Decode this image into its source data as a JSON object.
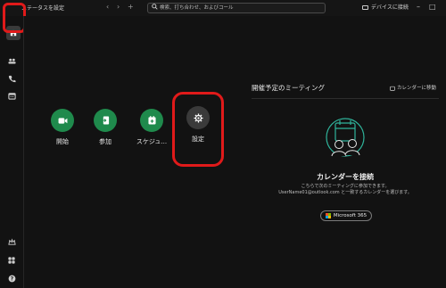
{
  "topbar": {
    "status_text": "ステータスを設定",
    "back": "‹",
    "forward": "›",
    "add": "+",
    "search_placeholder": "検索、打ち合わせ、およびコール",
    "device_label": "デバイスに接続",
    "minimize": "–",
    "maximize": "□"
  },
  "sidebar": {
    "items": [
      {
        "icon": "home-icon"
      },
      {
        "icon": "team-icon"
      },
      {
        "icon": "phone-icon"
      },
      {
        "icon": "calendar-icon"
      },
      {
        "icon": "whats-new-icon"
      },
      {
        "icon": "apps-icon"
      },
      {
        "icon": "help-icon"
      }
    ]
  },
  "actions": [
    {
      "label": "開始",
      "icon": "video-icon",
      "color": "#1f8a4c"
    },
    {
      "label": "参加",
      "icon": "join-icon",
      "color": "#1f8a4c"
    },
    {
      "label": "スケジュ...",
      "icon": "schedule-icon",
      "color": "#1f8a4c"
    },
    {
      "label": "設定",
      "icon": "gear-icon",
      "color": "#3a3a3a"
    }
  ],
  "meetings": {
    "title": "開催予定のミーティング",
    "move_to_calendar": "カレンダーに移動",
    "connect_title": "カレンダーを接続",
    "connect_desc_line1": "こちらで次のミーティングに参加できます。",
    "connect_desc_line2": "UserName01@outlook.com と一致するカレンダーを選びます。",
    "microsoft_button": "Microsoft 365"
  },
  "colors": {
    "highlight": "#e01a1a",
    "accent_green": "#1f8a4c",
    "illustration_teal": "#2fb39a"
  }
}
